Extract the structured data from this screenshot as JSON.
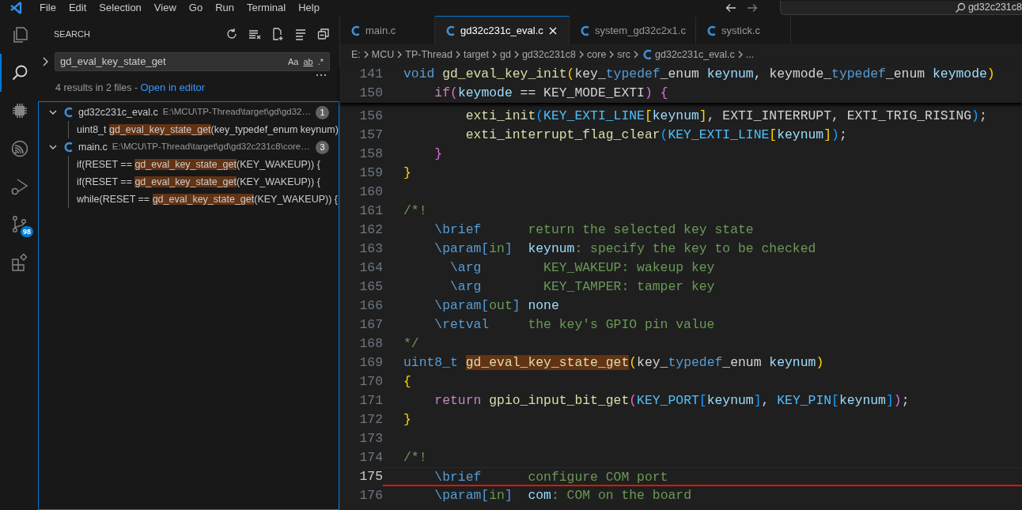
{
  "menu": [
    "File",
    "Edit",
    "Selection",
    "View",
    "Go",
    "Run",
    "Terminal",
    "Help"
  ],
  "command_center": {
    "text": "gd32c231c8"
  },
  "activity_bar": [
    {
      "kind": "files",
      "selected": false
    },
    {
      "kind": "search",
      "selected": true
    },
    {
      "kind": "chip",
      "selected": false
    },
    {
      "kind": "signal",
      "selected": false
    },
    {
      "kind": "debug",
      "selected": false
    },
    {
      "kind": "source_control",
      "selected": false,
      "badge": "98"
    },
    {
      "kind": "extensions",
      "selected": false
    }
  ],
  "search": {
    "title": "SEARCH",
    "query": "gd_eval_key_state_get",
    "options": [
      "Aa",
      "ab",
      ".*"
    ],
    "summary": "4 results in 2 files - ",
    "open_link": "Open in editor",
    "files": [
      {
        "name": "gd32c231c_eval.c",
        "path": "E:\\MCU\\TP-Thread\\target\\gd\\gd32…",
        "count": "1",
        "expanded": true,
        "matches": [
          {
            "before": "uint8_t ",
            "match": "gd_eval_key_state_get",
            "after": "(key_typedef_enum keynum)"
          }
        ]
      },
      {
        "name": "main.c",
        "path": "E:\\MCU\\TP-Thread\\target\\gd\\gd32c231c8\\core…",
        "count": "3",
        "expanded": true,
        "matches": [
          {
            "before": "if(RESET == ",
            "match": "gd_eval_key_state_get",
            "after": "(KEY_WAKEUP)) {"
          },
          {
            "before": "if(RESET == ",
            "match": "gd_eval_key_state_get",
            "after": "(KEY_WAKEUP)) {"
          },
          {
            "before": "while(RESET == ",
            "match": "gd_eval_key_state_get",
            "after": "(KEY_WAKEUP)) {"
          }
        ]
      }
    ]
  },
  "tabs": [
    {
      "label": "main.c",
      "selected": false
    },
    {
      "label": "gd32c231c_eval.c",
      "selected": true
    },
    {
      "label": "system_gd32c2x1.c",
      "selected": false
    },
    {
      "label": "systick.c",
      "selected": false
    }
  ],
  "breadcrumbs": [
    {
      "text": "E:",
      "kind": "folder"
    },
    {
      "text": "MCU",
      "kind": "folder"
    },
    {
      "text": "TP-Thread",
      "kind": "folder"
    },
    {
      "text": "target",
      "kind": "folder"
    },
    {
      "text": "gd",
      "kind": "folder"
    },
    {
      "text": "gd32c231c8",
      "kind": "folder"
    },
    {
      "text": "core",
      "kind": "folder"
    },
    {
      "text": "src",
      "kind": "folder"
    },
    {
      "text": "gd32c231c_eval.c",
      "kind": "file"
    },
    {
      "text": "...",
      "kind": "more"
    }
  ],
  "code": [
    {
      "number": "141",
      "sticky": true,
      "current": false,
      "tokens": [
        {
          "text": "void ",
          "kind": "keyword"
        },
        {
          "text": "gd_eval_key_init",
          "kind": "function"
        },
        {
          "text": "(",
          "kind": "bracket1"
        },
        {
          "text": "key_",
          "kind": "plain"
        },
        {
          "text": "typedef",
          "kind": "keyword"
        },
        {
          "text": "_enum ",
          "kind": "plain"
        },
        {
          "text": "keynum",
          "kind": "variable"
        },
        {
          "text": ", keymode_",
          "kind": "plain"
        },
        {
          "text": "typedef",
          "kind": "keyword"
        },
        {
          "text": "_enum ",
          "kind": "plain"
        },
        {
          "text": "keymode",
          "kind": "variable"
        },
        {
          "text": ")",
          "kind": "bracket1"
        }
      ]
    },
    {
      "number": "150",
      "sticky": true,
      "current": false,
      "tokens": [
        {
          "text": "    if",
          "kind": "control"
        },
        {
          "text": "(",
          "kind": "bracket2"
        },
        {
          "text": "keymode",
          "kind": "variable"
        },
        {
          "text": " == KEY_MODE_EXTI",
          "kind": "plain"
        },
        {
          "text": ") {",
          "kind": "bracket2"
        }
      ]
    },
    {
      "number": "156",
      "sticky": false,
      "current": false,
      "tokens": [
        {
          "text": "        exti_init",
          "kind": "function"
        },
        {
          "text": "(",
          "kind": "bracket3"
        },
        {
          "text": "KEY_EXTI_LINE",
          "kind": "macro"
        },
        {
          "text": "[",
          "kind": "bracket1"
        },
        {
          "text": "keynum",
          "kind": "variable"
        },
        {
          "text": "]",
          "kind": "bracket1"
        },
        {
          "text": ", EXTI_INTERRUPT, EXTI_TRIG_RISING",
          "kind": "plain"
        },
        {
          "text": ")",
          "kind": "bracket3"
        },
        {
          "text": ";",
          "kind": "plain"
        }
      ]
    },
    {
      "number": "157",
      "sticky": false,
      "current": false,
      "tokens": [
        {
          "text": "        exti_interrupt_flag_clear",
          "kind": "function"
        },
        {
          "text": "(",
          "kind": "bracket3"
        },
        {
          "text": "KEY_EXTI_LINE",
          "kind": "macro"
        },
        {
          "text": "[",
          "kind": "bracket1"
        },
        {
          "text": "keynum",
          "kind": "variable"
        },
        {
          "text": "]",
          "kind": "bracket1"
        },
        {
          "text": ")",
          "kind": "bracket3"
        },
        {
          "text": ";",
          "kind": "plain"
        }
      ]
    },
    {
      "number": "158",
      "sticky": false,
      "current": false,
      "tokens": [
        {
          "text": "    }",
          "kind": "bracket2"
        }
      ]
    },
    {
      "number": "159",
      "sticky": false,
      "current": false,
      "tokens": [
        {
          "text": "}",
          "kind": "bracket1"
        }
      ]
    },
    {
      "number": "160",
      "sticky": false,
      "current": false
    },
    {
      "number": "161",
      "sticky": false,
      "current": false,
      "tokens": [
        {
          "text": "/*!",
          "kind": "comment"
        }
      ]
    },
    {
      "number": "162",
      "sticky": false,
      "current": false,
      "tokens": [
        {
          "text": "    \\brief",
          "kind": "doctag"
        },
        {
          "text": "      return the selected key state",
          "kind": "comment"
        }
      ]
    },
    {
      "number": "163",
      "sticky": false,
      "current": false,
      "tokens": [
        {
          "text": "    \\param[",
          "kind": "doctag"
        },
        {
          "text": "in",
          "kind": "comment"
        },
        {
          "text": "]  ",
          "kind": "doctag"
        },
        {
          "text": "keynum",
          "kind": "variable"
        },
        {
          "text": ": specify the key to be checked",
          "kind": "comment"
        }
      ]
    },
    {
      "number": "164",
      "sticky": false,
      "current": false,
      "tokens": [
        {
          "text": "      \\arg",
          "kind": "doctag"
        },
        {
          "text": "        KEY_WAKEUP: wakeup key",
          "kind": "comment"
        }
      ]
    },
    {
      "number": "165",
      "sticky": false,
      "current": false,
      "tokens": [
        {
          "text": "      \\arg",
          "kind": "doctag"
        },
        {
          "text": "        KEY_TAMPER: tamper key",
          "kind": "comment"
        }
      ]
    },
    {
      "number": "166",
      "sticky": false,
      "current": false,
      "tokens": [
        {
          "text": "    \\param[",
          "kind": "doctag"
        },
        {
          "text": "out",
          "kind": "comment"
        },
        {
          "text": "] ",
          "kind": "doctag"
        },
        {
          "text": "none",
          "kind": "variable"
        }
      ]
    },
    {
      "number": "167",
      "sticky": false,
      "current": false,
      "tokens": [
        {
          "text": "    \\retval",
          "kind": "doctag"
        },
        {
          "text": "     the key's GPIO pin value",
          "kind": "comment"
        }
      ]
    },
    {
      "number": "168",
      "sticky": false,
      "current": false,
      "tokens": [
        {
          "text": "*/",
          "kind": "comment"
        }
      ]
    },
    {
      "number": "169",
      "sticky": false,
      "current": false,
      "tokens": [
        {
          "text": "uint8_t ",
          "kind": "keyword"
        },
        {
          "text": "gd_eval_key_state_get",
          "kind": "function",
          "match": true
        },
        {
          "text": "(",
          "kind": "bracket1"
        },
        {
          "text": "key_",
          "kind": "plain"
        },
        {
          "text": "typedef",
          "kind": "keyword"
        },
        {
          "text": "_enum ",
          "kind": "plain"
        },
        {
          "text": "keynum",
          "kind": "variable"
        },
        {
          "text": ")",
          "kind": "bracket1"
        }
      ]
    },
    {
      "number": "170",
      "sticky": false,
      "current": false,
      "tokens": [
        {
          "text": "{",
          "kind": "bracket1"
        }
      ]
    },
    {
      "number": "171",
      "sticky": false,
      "current": false,
      "tokens": [
        {
          "text": "    return ",
          "kind": "control"
        },
        {
          "text": "gpio_input_bit_get",
          "kind": "function"
        },
        {
          "text": "(",
          "kind": "bracket2"
        },
        {
          "text": "KEY_PORT",
          "kind": "macro"
        },
        {
          "text": "[",
          "kind": "bracket3"
        },
        {
          "text": "keynum",
          "kind": "variable"
        },
        {
          "text": "]",
          "kind": "bracket3"
        },
        {
          "text": ", ",
          "kind": "plain"
        },
        {
          "text": "KEY_PIN",
          "kind": "macro"
        },
        {
          "text": "[",
          "kind": "bracket3"
        },
        {
          "text": "keynum",
          "kind": "variable"
        },
        {
          "text": "]",
          "kind": "bracket3"
        },
        {
          "text": ")",
          "kind": "bracket2"
        },
        {
          "text": ";",
          "kind": "plain"
        }
      ]
    },
    {
      "number": "172",
      "sticky": false,
      "current": false,
      "tokens": [
        {
          "text": "}",
          "kind": "bracket1"
        }
      ]
    },
    {
      "number": "173",
      "sticky": false,
      "current": false
    },
    {
      "number": "174",
      "sticky": false,
      "current": false,
      "tokens": [
        {
          "text": "/*!",
          "kind": "comment"
        }
      ]
    },
    {
      "number": "175",
      "sticky": false,
      "current": true,
      "tokens": [
        {
          "text": "    \\brief",
          "kind": "doctag"
        },
        {
          "text": "      configure COM port",
          "kind": "comment"
        }
      ]
    },
    {
      "number": "176",
      "sticky": false,
      "current": false,
      "tokens": [
        {
          "text": "    \\param[",
          "kind": "doctag"
        },
        {
          "text": "in",
          "kind": "comment"
        },
        {
          "text": "]  ",
          "kind": "doctag"
        },
        {
          "text": "com",
          "kind": "variable"
        },
        {
          "text": ": COM on the board",
          "kind": "comment"
        }
      ]
    }
  ]
}
